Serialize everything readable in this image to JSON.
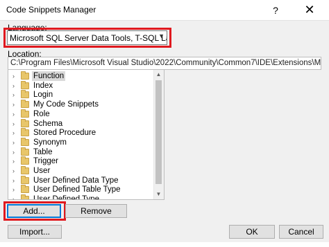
{
  "window": {
    "title": "Code Snippets Manager",
    "help_glyph": "?",
    "close_glyph": "✕"
  },
  "language": {
    "label": "Language:",
    "selected": "Microsoft SQL Server Data Tools, T-SQL Language Se"
  },
  "location": {
    "label": "Location:",
    "value": "C:\\Program Files\\Microsoft Visual Studio\\2022\\Community\\Common7\\IDE\\Extensions\\Microsoft\\SQLEditor\\S"
  },
  "tree": {
    "items": [
      {
        "label": "Function",
        "selected": true
      },
      {
        "label": "Index"
      },
      {
        "label": "Login"
      },
      {
        "label": "My Code Snippets"
      },
      {
        "label": "Role"
      },
      {
        "label": "Schema"
      },
      {
        "label": "Stored Procedure"
      },
      {
        "label": "Synonym"
      },
      {
        "label": "Table"
      },
      {
        "label": "Trigger"
      },
      {
        "label": "User"
      },
      {
        "label": "User Defined Data Type"
      },
      {
        "label": "User Defined Table Type"
      },
      {
        "label": "User Defined Type"
      }
    ]
  },
  "buttons": {
    "add": "Add...",
    "remove": "Remove",
    "import": "Import...",
    "ok": "OK",
    "cancel": "Cancel"
  },
  "colors": {
    "highlight": "#e0191f",
    "focus": "#0078d7"
  }
}
